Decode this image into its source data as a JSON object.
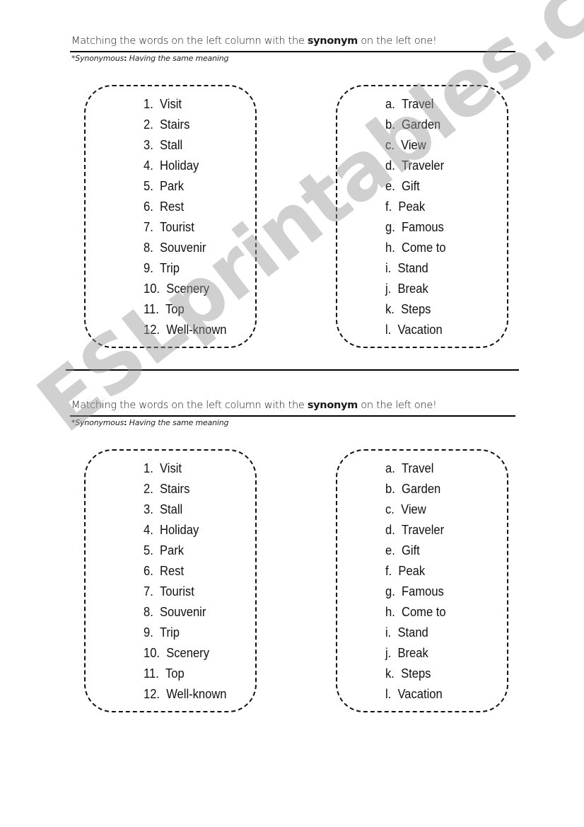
{
  "worksheets": [
    {
      "instruction_prefix": "Matching the words on the left column with the ",
      "instruction_bold": "synonym",
      "instruction_suffix": " on the left one!",
      "note_prefix": "*Synonymous",
      "note_colon": ":",
      "note_suffix": " Having the same meaning",
      "left_items": [
        {
          "marker": "1.",
          "word": "Visit"
        },
        {
          "marker": "2.",
          "word": "Stairs"
        },
        {
          "marker": "3.",
          "word": "Stall"
        },
        {
          "marker": "4.",
          "word": "Holiday"
        },
        {
          "marker": "5.",
          "word": "Park"
        },
        {
          "marker": "6.",
          "word": "Rest"
        },
        {
          "marker": "7.",
          "word": "Tourist"
        },
        {
          "marker": "8.",
          "word": "Souvenir"
        },
        {
          "marker": "9.",
          "word": "Trip"
        },
        {
          "marker": "10.",
          "word": "Scenery"
        },
        {
          "marker": "11.",
          "word": "Top"
        },
        {
          "marker": "12.",
          "word": "Well-known"
        }
      ],
      "right_items": [
        {
          "marker": "a.",
          "word": "Travel"
        },
        {
          "marker": "b.",
          "word": "Garden"
        },
        {
          "marker": "c.",
          "word": "View"
        },
        {
          "marker": "d.",
          "word": "Traveler"
        },
        {
          "marker": "e.",
          "word": "Gift"
        },
        {
          "marker": "f.",
          "word": "Peak"
        },
        {
          "marker": "g.",
          "word": "Famous"
        },
        {
          "marker": "h.",
          "word": "Come to"
        },
        {
          "marker": "i.",
          "word": "Stand"
        },
        {
          "marker": "j.",
          "word": "Break"
        },
        {
          "marker": "k.",
          "word": "Steps"
        },
        {
          "marker": "l.",
          "word": "Vacation"
        }
      ]
    },
    {
      "instruction_prefix": "Matching the words on the left column with the ",
      "instruction_bold": "synonym",
      "instruction_suffix": " on the left one!",
      "note_prefix": "*Synonymous",
      "note_colon": ":",
      "note_suffix": " Having the same meaning",
      "left_items": [
        {
          "marker": "1.",
          "word": "Visit"
        },
        {
          "marker": "2.",
          "word": "Stairs"
        },
        {
          "marker": "3.",
          "word": "Stall"
        },
        {
          "marker": "4.",
          "word": "Holiday"
        },
        {
          "marker": "5.",
          "word": "Park"
        },
        {
          "marker": "6.",
          "word": "Rest"
        },
        {
          "marker": "7.",
          "word": "Tourist"
        },
        {
          "marker": "8.",
          "word": "Souvenir"
        },
        {
          "marker": "9.",
          "word": "Trip"
        },
        {
          "marker": "10.",
          "word": "Scenery"
        },
        {
          "marker": "11.",
          "word": "Top"
        },
        {
          "marker": "12.",
          "word": "Well-known"
        }
      ],
      "right_items": [
        {
          "marker": "a.",
          "word": "Travel"
        },
        {
          "marker": "b.",
          "word": "Garden"
        },
        {
          "marker": "c.",
          "word": "View"
        },
        {
          "marker": "d.",
          "word": "Traveler"
        },
        {
          "marker": "e.",
          "word": "Gift"
        },
        {
          "marker": "f.",
          "word": "Peak"
        },
        {
          "marker": "g.",
          "word": "Famous"
        },
        {
          "marker": "h.",
          "word": "Come to"
        },
        {
          "marker": "i.",
          "word": "Stand"
        },
        {
          "marker": "j.",
          "word": "Break"
        },
        {
          "marker": "k.",
          "word": "Steps"
        },
        {
          "marker": "l.",
          "word": "Vacation"
        }
      ]
    }
  ],
  "watermark": "ESLprintables.com"
}
